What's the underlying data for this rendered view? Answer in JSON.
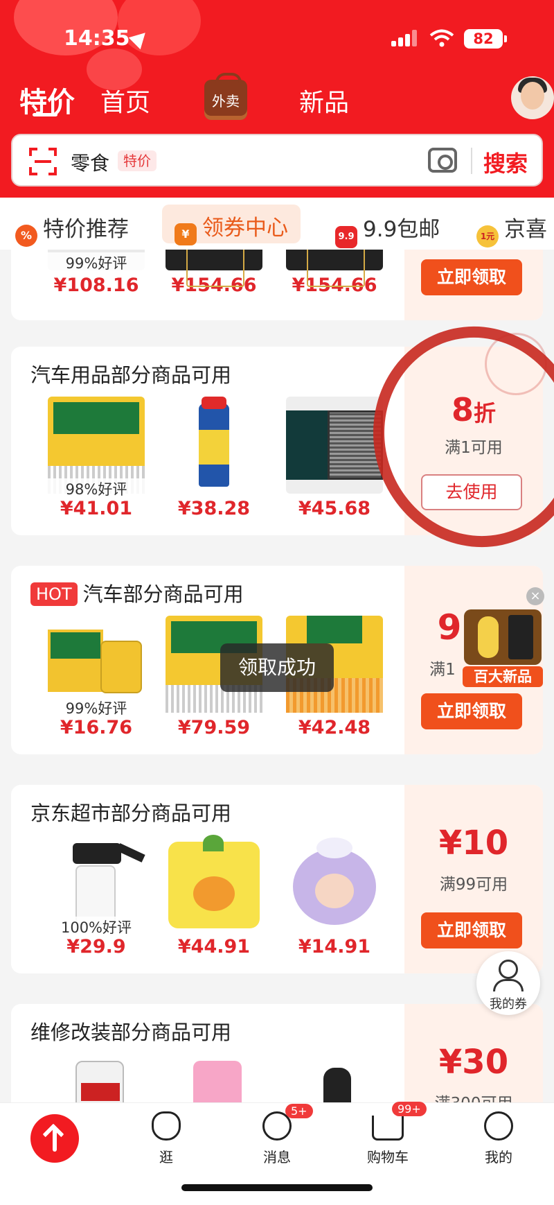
{
  "status_bar": {
    "time": "14:35",
    "battery": "82"
  },
  "top_nav": {
    "active_tab": "特价",
    "tabs": [
      "首页",
      "新品"
    ],
    "takeout_label": "外卖"
  },
  "search": {
    "text": "零食",
    "tag": "特价",
    "button": "搜索"
  },
  "chips": [
    {
      "label": "特价推荐",
      "icon": "%"
    },
    {
      "label": "领券中心",
      "icon": "¥"
    },
    {
      "label": "9.9包邮",
      "icon": "9.9"
    },
    {
      "label": "京喜",
      "icon": "1元"
    }
  ],
  "cards": [
    {
      "title": "",
      "products": [
        {
          "price": "¥108.16",
          "rating": "99%好评"
        },
        {
          "price": "¥154.66",
          "rating": ""
        },
        {
          "price": "¥154.66",
          "rating": ""
        }
      ],
      "coupon": {
        "value": "",
        "condition": "",
        "button": "立即领取"
      }
    },
    {
      "title": "汽车用品部分商品可用",
      "products": [
        {
          "price": "¥41.01",
          "rating": "98%好评"
        },
        {
          "price": "¥38.28",
          "rating": ""
        },
        {
          "price": "¥45.68",
          "rating": ""
        }
      ],
      "coupon": {
        "value": "8",
        "unit": "折",
        "condition": "满1可用",
        "button": "去使用"
      }
    },
    {
      "title": "汽车部分商品可用",
      "hot": "HOT",
      "products": [
        {
          "price": "¥16.76",
          "rating": "99%好评"
        },
        {
          "price": "¥79.59",
          "rating": ""
        },
        {
          "price": "¥42.48",
          "rating": ""
        }
      ],
      "coupon": {
        "value": "9",
        "condition": "满1",
        "button": "立即领取"
      }
    },
    {
      "title": "京东超市部分商品可用",
      "products": [
        {
          "price": "¥29.9",
          "rating": "100%好评"
        },
        {
          "price": "¥44.91",
          "rating": ""
        },
        {
          "price": "¥14.91",
          "rating": ""
        }
      ],
      "coupon": {
        "value": "¥10",
        "condition": "满99可用",
        "button": "立即领取"
      }
    },
    {
      "title": "维修改装部分商品可用",
      "products": [],
      "coupon": {
        "value": "¥30",
        "condition": "满300可用",
        "button": ""
      }
    }
  ],
  "toast": "领取成功",
  "promo": {
    "tag": "百大新品"
  },
  "my_coupon": "我的券",
  "tabbar": [
    {
      "label": "逛"
    },
    {
      "label": "消息",
      "badge": "5+"
    },
    {
      "label": "购物车",
      "badge": "99+"
    },
    {
      "label": "我的"
    }
  ],
  "colors": {
    "brand_red": "#f21b21",
    "price_red": "#e0262b",
    "orange_button": "#f0501c"
  }
}
